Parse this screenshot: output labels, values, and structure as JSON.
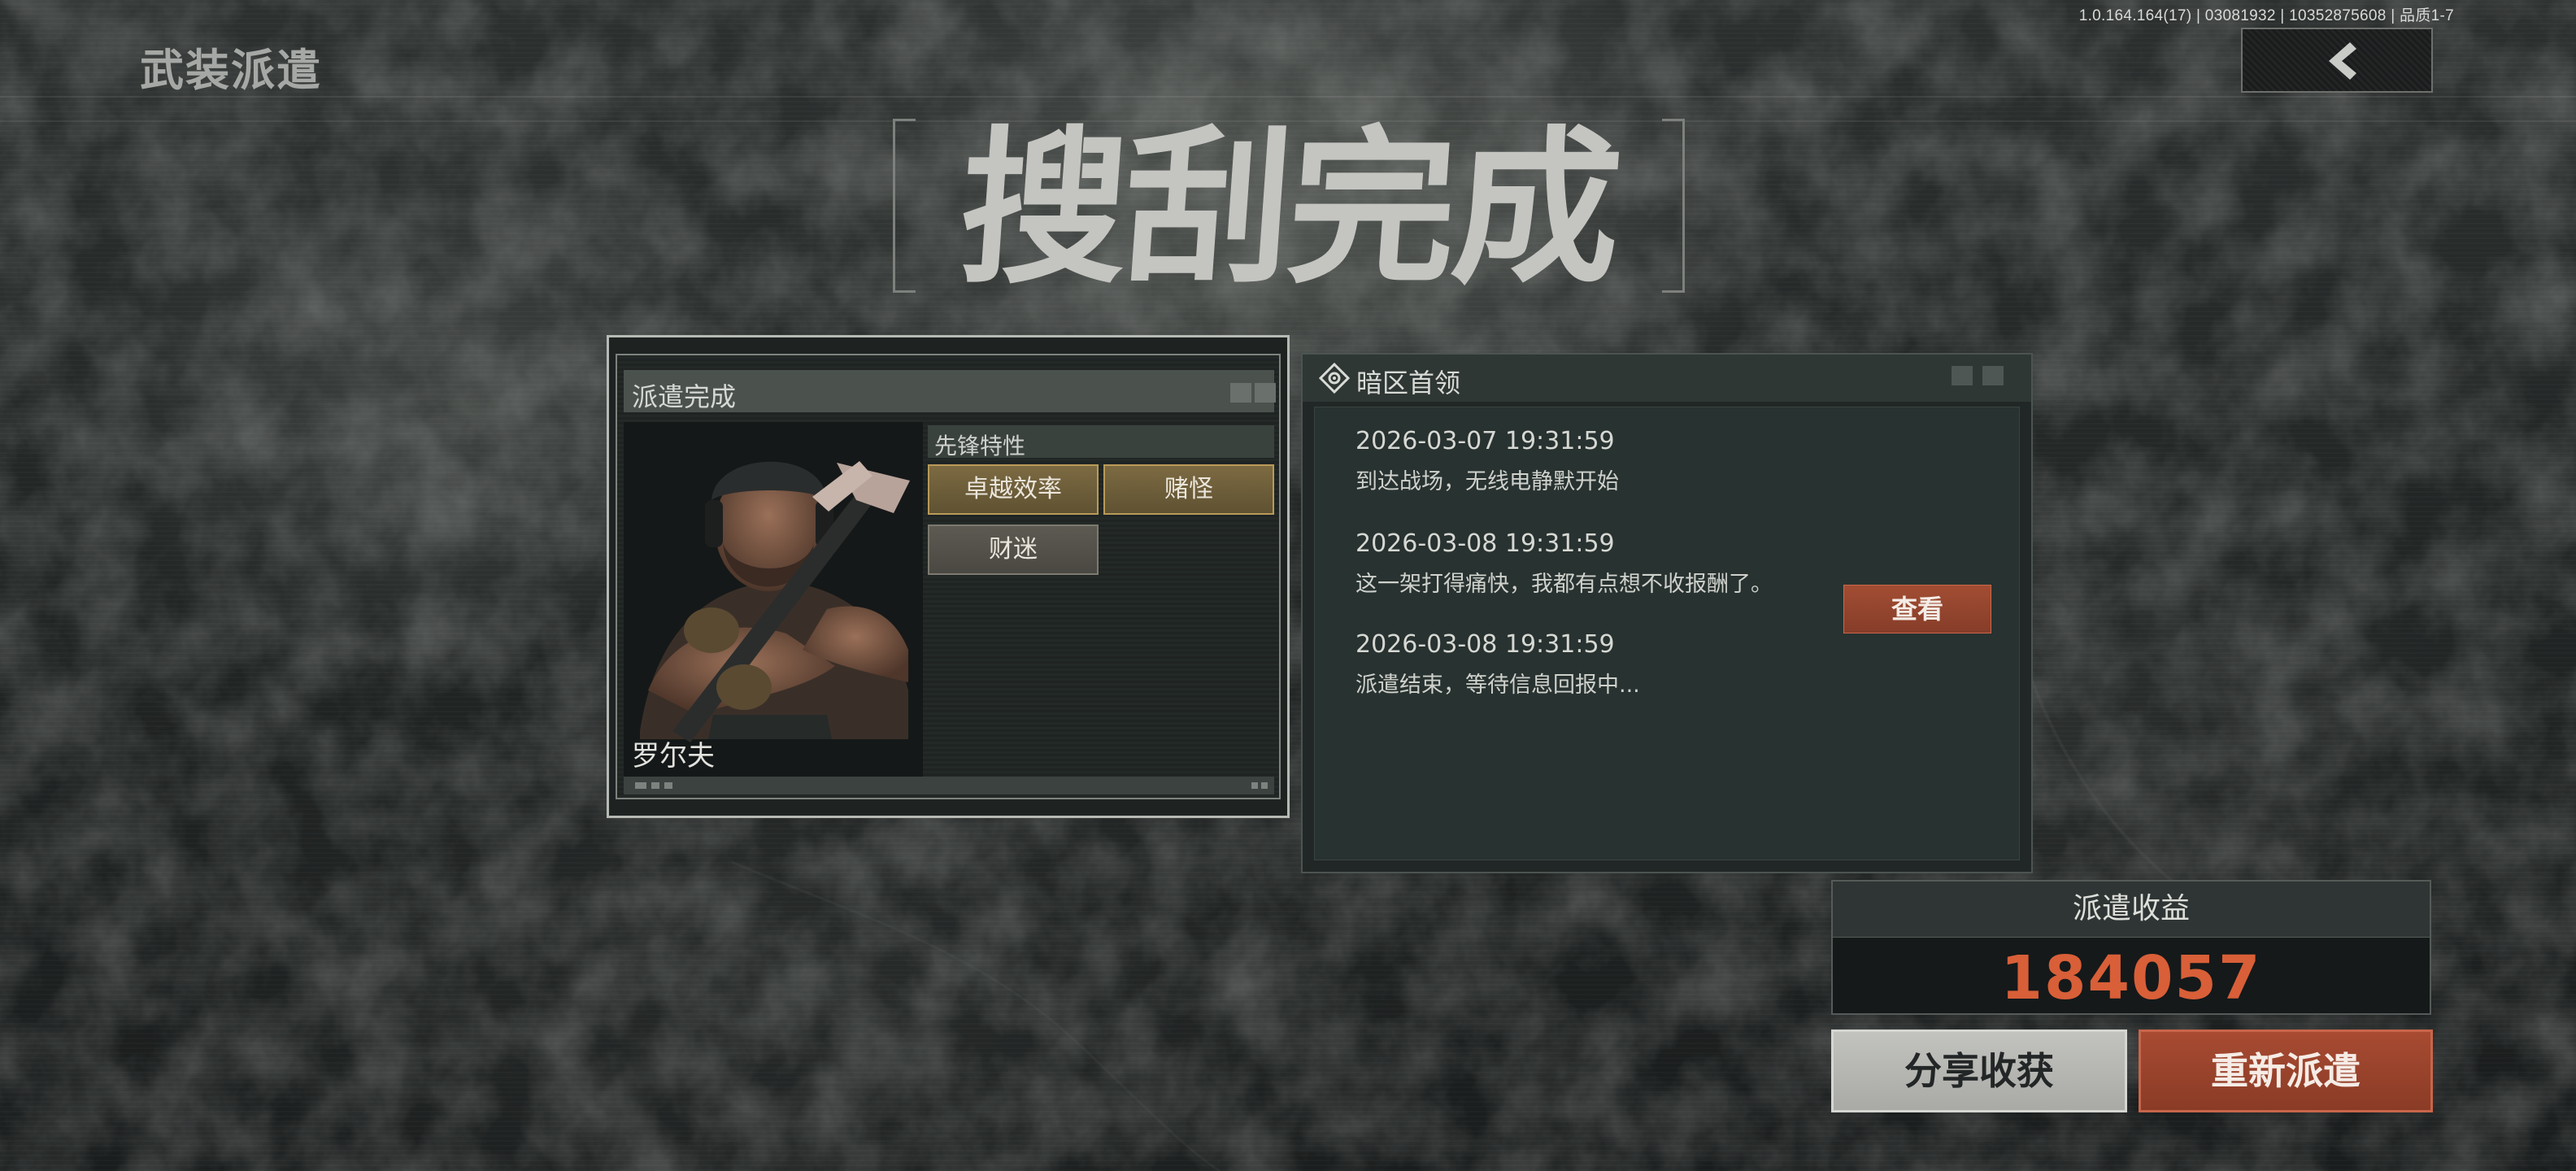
{
  "version_info": "1.0.164.164(17) | 03081932 | 10352875608 | 品质1-7",
  "page_title": "武装派遣",
  "headline": "搜刮完成",
  "dispatch_panel": {
    "title": "派遣完成",
    "operator_name": "罗尔夫",
    "traits_header": "先锋特性",
    "traits": [
      {
        "label": "卓越效率",
        "style": "gold"
      },
      {
        "label": "赌怪",
        "style": "gold"
      },
      {
        "label": "财迷",
        "style": "grey"
      }
    ]
  },
  "log_panel": {
    "title": "暗区首领",
    "entries": [
      {
        "time": "2026-03-07 19:31:59",
        "message": "到达战场，无线电静默开始"
      },
      {
        "time": "2026-03-08 19:31:59",
        "message": "这一架打得痛快，我都有点想不收报酬了。"
      },
      {
        "time": "2026-03-08 19:31:59",
        "message": "派遣结束，等待信息回报中..."
      }
    ],
    "view_button": "查看"
  },
  "earnings": {
    "label": "派遣收益",
    "value": "184057"
  },
  "buttons": {
    "share": "分享收获",
    "redispatch": "重新派遣"
  },
  "icons": {
    "back": "chevron-left-icon",
    "log": "diamond-target-icon"
  },
  "colors": {
    "accent": "#d85f38",
    "action": "#a24d33",
    "trait_gold": "#7c6a42"
  }
}
